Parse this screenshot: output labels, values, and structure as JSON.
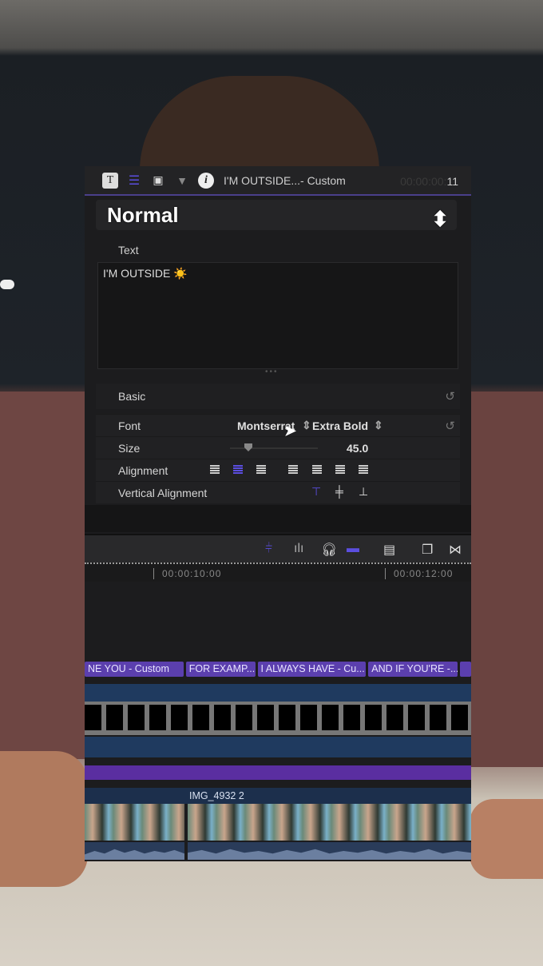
{
  "inspector": {
    "header": {
      "title": "I'M OUTSIDE...- Custom",
      "timecode_dim": "00:00:00:",
      "timecode_frame": "11",
      "icons": [
        "text-inspector-icon",
        "text-tab-icon",
        "video-inspector-icon",
        "filter-icon",
        "info-icon"
      ]
    },
    "preset": "Normal",
    "text_section": {
      "label": "Text",
      "value": "I'M OUTSIDE ☀️"
    },
    "basic": {
      "label": "Basic",
      "font": {
        "label": "Font",
        "family": "Montserrat",
        "weight": "Extra Bold"
      },
      "size": {
        "label": "Size",
        "value": "45.0"
      },
      "alignment": {
        "label": "Alignment",
        "selected": "center"
      },
      "vertical_alignment": {
        "label": "Vertical Alignment",
        "selected": "top"
      }
    }
  },
  "timeline": {
    "ruler": [
      "00:00:10:00",
      "00:00:12:00"
    ],
    "title_clips": [
      "NE YOU  - Custom",
      "FOR EXAMP...",
      "I ALWAYS HAVE - Cu...",
      "AND IF YOU'RE -..."
    ],
    "video_clip": "IMG_4932 2"
  },
  "colors": {
    "accent": "#5b4ee0",
    "title_clip": "#5b3fae",
    "band": "#1f3a5f"
  }
}
